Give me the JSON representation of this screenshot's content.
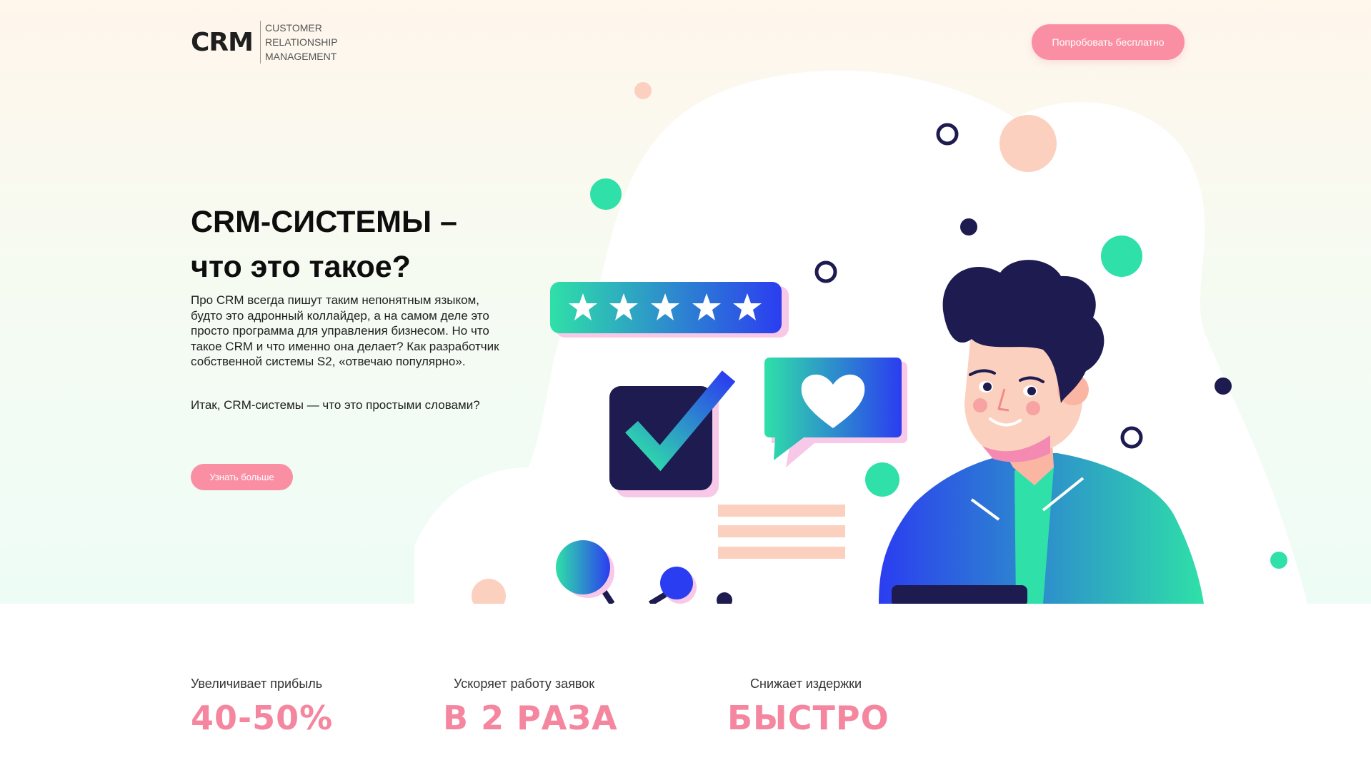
{
  "header": {
    "logo_mark": "CRM",
    "logo_lines": [
      "CUSTOMER",
      "RELATIONSHIP",
      "MANAGEMENT"
    ],
    "cta_label": "Попробовать бесплатно"
  },
  "hero": {
    "title_line1": "CRM-СИСТЕМЫ –",
    "title_line2": "что это такое?",
    "paragraph1": "Про CRM всегда пишут таким непонятным языком, будто это адронный коллайдер, а на самом деле это просто программа для управления бизнесом. Но что такое CRM и что именно она делает? Как разработчик собственной системы S2, «отвечаю популярно».",
    "paragraph2": "Итак, CRM-системы — что это простыми словами?",
    "more_label": "Узнать больше"
  },
  "stats": [
    {
      "label": "Увеличивает прибыль",
      "value": "40-50%"
    },
    {
      "label": "Ускоряет работу заявок",
      "value": "В 2 РАЗА"
    },
    {
      "label": "Снижает издержки",
      "value": "БЫСТРО"
    }
  ],
  "colors": {
    "accent_pink": "#fa8fa3",
    "stat_pink": "#f4879f",
    "navy": "#1d1b4f",
    "teal": "#2fe0a8",
    "blue": "#2b3df0",
    "peach": "#fcd0bf"
  }
}
